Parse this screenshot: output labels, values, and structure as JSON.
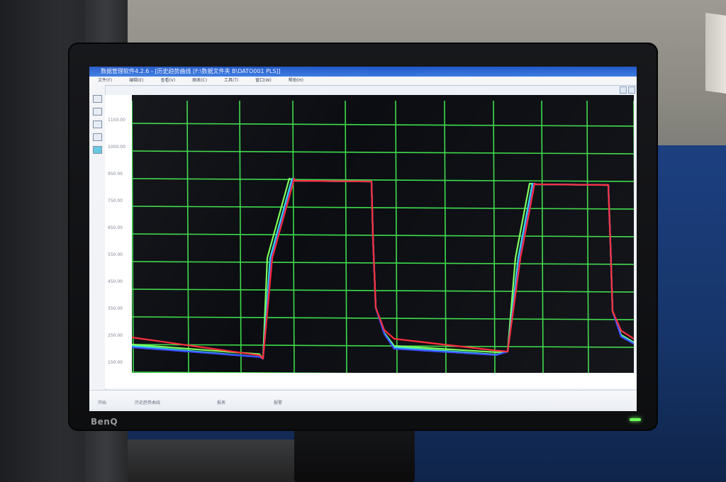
{
  "scene": {
    "monitor_brand": "BenQ",
    "power_led_color": "#6cff5a",
    "wall_colors": {
      "upper": "#8d8b84",
      "lower": "#163468"
    }
  },
  "app": {
    "title": "数据管理软件4.2.6 - [历史趋势曲线 [F:\\数据文件夹 B\\DATO001 PLS]]",
    "menu_items": [
      "文件(F)",
      "编辑(E)",
      "查看(V)",
      "图表(C)",
      "工具(T)",
      "窗口(W)",
      "帮助(H)"
    ],
    "toolbar_icons": [
      "open-icon",
      "save-icon",
      "print-icon",
      "zoom-icon",
      "cursor-icon"
    ]
  },
  "chart_data": {
    "type": "line",
    "background": "#0b0d12",
    "grid_color": "#3ddc4a",
    "grid": true,
    "y_ticks": [
      "1150.00",
      "1000.00",
      "950.00",
      "750.00",
      "650.00",
      "550.00",
      "450.00",
      "350.00",
      "250.00",
      "150.00"
    ],
    "series_colors": [
      "#ff2a3a",
      "#3b4bff",
      "#33e0e0",
      "#7dff5a"
    ],
    "description": ""
  },
  "statusbar": {
    "items": [
      "开始",
      "历史趋势曲线",
      "报表",
      "报警"
    ]
  }
}
